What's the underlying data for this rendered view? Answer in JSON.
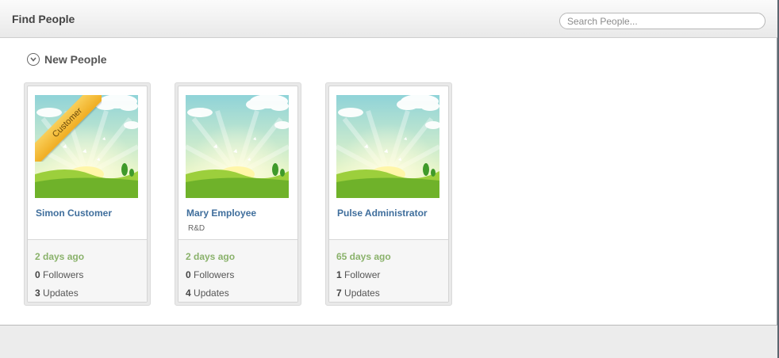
{
  "header": {
    "title": "Find People",
    "search_placeholder": "Search People..."
  },
  "section": {
    "title": "New People",
    "icon": "chevron-down-circle-icon"
  },
  "people": [
    {
      "name": "Simon Customer",
      "department": "",
      "badge": "Customer",
      "time_ago": "2 days ago",
      "followers_count": "0",
      "followers_label": "Followers",
      "updates_count": "3",
      "updates_label": "Updates"
    },
    {
      "name": "Mary Employee",
      "department": "R&D",
      "badge": "",
      "time_ago": "2 days ago",
      "followers_count": "0",
      "followers_label": "Followers",
      "updates_count": "4",
      "updates_label": "Updates"
    },
    {
      "name": "Pulse Administrator",
      "department": "",
      "badge": "",
      "time_ago": "65 days ago",
      "followers_count": "1",
      "followers_label": "Follower",
      "updates_count": "7",
      "updates_label": "Updates"
    }
  ],
  "colors": {
    "link": "#3f6e9c",
    "time": "#8ab26b",
    "ribbon": "#f0ad22"
  }
}
